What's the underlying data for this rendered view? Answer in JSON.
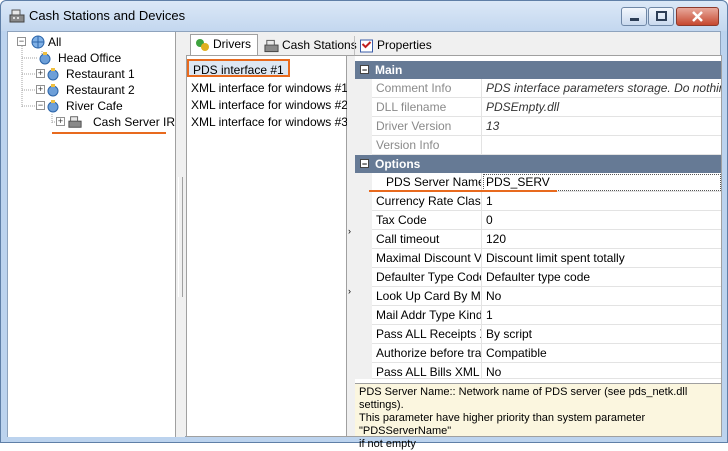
{
  "window": {
    "title": "Cash Stations and Devices"
  },
  "tree": {
    "root": "All",
    "items": [
      "Head Office",
      "Restaurant 1",
      "Restaurant 2",
      "River Cafe"
    ],
    "child": "Cash Server IR"
  },
  "tabs": [
    {
      "label": "Drivers"
    },
    {
      "label": "Cash Stations"
    },
    {
      "label": "Properties"
    }
  ],
  "drivers": [
    "PDS interface #1",
    "XML interface for windows #1",
    "XML interface for windows #2",
    "XML interface for windows #3"
  ],
  "grid": {
    "main_label": "Main",
    "main_rows": [
      {
        "name": "Comment Info",
        "value": "PDS interface parameters storage. Do nothing as i"
      },
      {
        "name": "DLL filename",
        "value": "PDSEmpty.dll"
      },
      {
        "name": "Driver Version",
        "value": "13"
      },
      {
        "name": "Version Info",
        "value": ""
      }
    ],
    "options_label": "Options",
    "selected": {
      "name": "PDS Server Name",
      "value": "PDS_SERV"
    },
    "options_rows": [
      {
        "name": "Currency Rate Class C",
        "value": "1"
      },
      {
        "name": "Tax Code",
        "value": "0"
      },
      {
        "name": "Call timeout",
        "value": "120"
      },
      {
        "name": "Maximal Discount Valu",
        "value": "Discount limit spent totally"
      },
      {
        "name": "Defaulter Type Code a",
        "value": "Defaulter type code"
      },
      {
        "name": "Look Up Card By Mail",
        "value": "No"
      },
      {
        "name": "Mail Addr Type Kind",
        "value": "1"
      },
      {
        "name": "Pass ALL Receipts XN",
        "value": "By script"
      },
      {
        "name": "Authorize before trans",
        "value": "Compatible"
      },
      {
        "name": "Pass ALL Bills XML da",
        "value": "No"
      }
    ]
  },
  "description": {
    "line1": "PDS Server Name:: Network name of PDS server (see pds_netk.dll settings).",
    "line2": "This parameter have higher priority than system parameter \"PDSServerName\"",
    "line3": "if not empty"
  },
  "colors": {
    "accent": "#e86a1e",
    "category_bar": "#667a95"
  }
}
